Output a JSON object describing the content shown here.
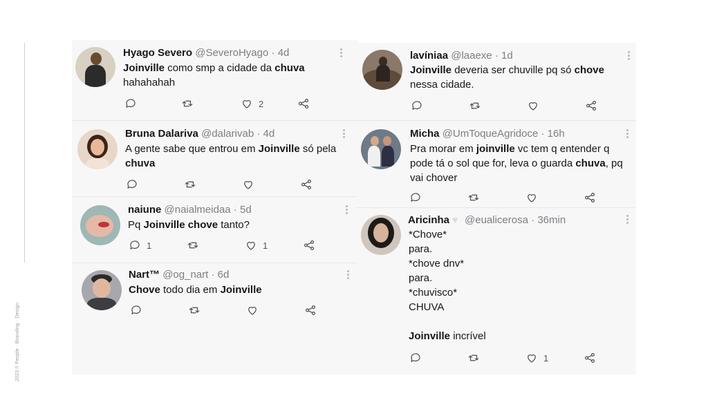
{
  "footer": {
    "caption": "2023 // People · Branding · Design"
  },
  "tweets_left": [
    {
      "name": "Hyago Severo",
      "handle": "@SeveroHyago",
      "separator": "·",
      "time": "4d",
      "segments": [
        [
          "Joinville",
          true
        ],
        [
          " como smp a cidade da ",
          false
        ],
        [
          "chuva",
          true
        ]
      ],
      "line2": "hahahahah",
      "likes": "2",
      "replies": ""
    },
    {
      "name": "Bruna Dalariva",
      "handle": "@dalarivab",
      "separator": "·",
      "time": "4d",
      "line1a": "A gente sabe que entrou em ",
      "line1b": "Joinville",
      "line1c": " só pela",
      "line2": "chuva",
      "likes": "",
      "replies": ""
    },
    {
      "name": "naiune",
      "handle": "@naialmeidaa",
      "separator": "·",
      "time": "5d",
      "t1": "Pq ",
      "t2": "Joinville chove",
      "t3": " tanto?",
      "likes": "1",
      "replies": "1"
    },
    {
      "name": "Nart™",
      "handle": "@og_nart",
      "separator": "·",
      "time": "6d",
      "t1": "Chove",
      "t2": " todo dia em ",
      "t3": "Joinville",
      "likes": "",
      "replies": ""
    }
  ],
  "tweets_right": [
    {
      "name": "lavíniaa",
      "handle": "@laaexe",
      "separator": "·",
      "time": "1d",
      "t1": "Joinville",
      "t2": " deveria ser chuville pq só ",
      "t3": "chove",
      "line2": "nessa cidade.",
      "likes": ""
    },
    {
      "name": "Micha",
      "handle": "@UmToqueAgridoce",
      "separator": "·",
      "time": "16h",
      "l1a": "Pra morar em ",
      "l1b": "joinville",
      "l1c": " vc tem q entender q",
      "l2a": "pode tá o sol que for, leva o guarda ",
      "l2b": "chuva",
      "l2c": ", pq",
      "l3": "vai chover",
      "likes": ""
    },
    {
      "name": "Aricinha",
      "handle": "@eualicerosa",
      "separator": "·",
      "time": "36min",
      "lines": [
        "*Chove*",
        "para.",
        "*chove dnv*",
        "para.",
        "*chuvisco*",
        "CHUVA"
      ],
      "last_a": "Joinville",
      "last_b": " incrível",
      "likes": "1"
    }
  ],
  "icons": {
    "reply": "reply-icon",
    "retweet": "retweet-icon",
    "like": "heart-icon",
    "share": "share-icon",
    "more": "more-options-icon"
  },
  "colors": {
    "text": "#14171a",
    "muted": "#7a7f84",
    "card": "#f7f7f7"
  }
}
